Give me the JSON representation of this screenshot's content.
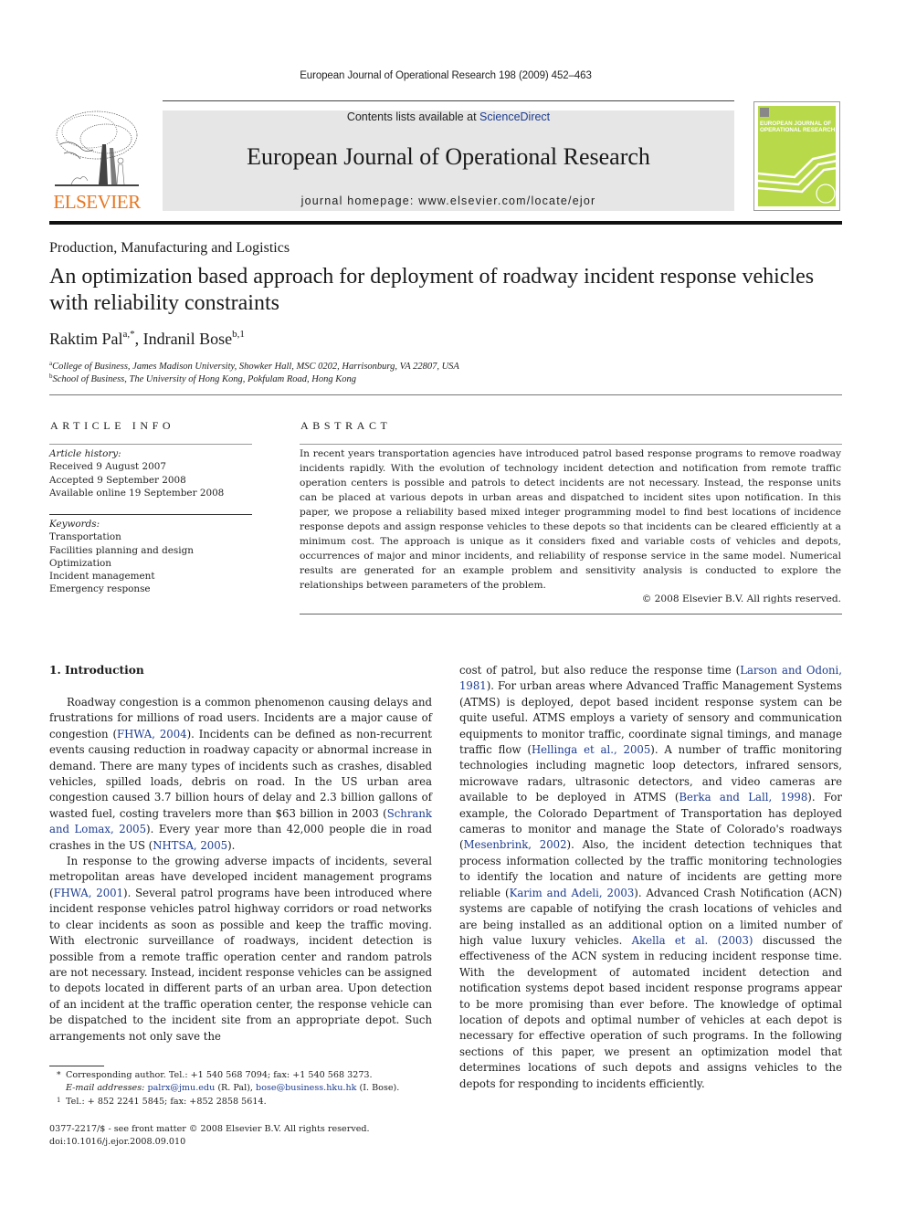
{
  "running_header": "European Journal of Operational Research 198 (2009) 452–463",
  "masthead": {
    "contents_prefix": "Contents lists available at ",
    "contents_link": "ScienceDirect",
    "journal_title": "European Journal of Operational Research",
    "homepage": "journal homepage: www.elsevier.com/locate/ejor",
    "publisher_logo_text": "ELSEVIER",
    "cover_title_line1": "EUROPEAN JOURNAL OF",
    "cover_title_line2": "OPERATIONAL RESEARCH",
    "colors": {
      "publisher_orange": "#e87722",
      "link_blue": "#1d3c8f",
      "cover_green": "#b8d94a",
      "box_grey": "#e6e6e6"
    }
  },
  "article": {
    "section": "Production, Manufacturing and Logistics",
    "title": "An optimization based approach for deployment of roadway incident response vehicles with reliability constraints",
    "authors": [
      {
        "name": "Raktim Pal",
        "marks": "a,*"
      },
      {
        "name": "Indranil Bose",
        "marks": "b,1"
      }
    ],
    "author_separator": ", ",
    "affiliations": [
      {
        "mark": "a",
        "text": "College of Business, James Madison University, Showker Hall, MSC 0202, Harrisonburg, VA 22807, USA"
      },
      {
        "mark": "b",
        "text": "School of Business, The University of Hong Kong, Pokfulam Road, Hong Kong"
      }
    ]
  },
  "article_info": {
    "heading": "ARTICLE INFO",
    "history_label": "Article history:",
    "history": [
      "Received 9 August 2007",
      "Accepted 9 September 2008",
      "Available online 19 September 2008"
    ],
    "keywords_label": "Keywords:",
    "keywords": [
      "Transportation",
      "Facilities planning and design",
      "Optimization",
      "Incident management",
      "Emergency response"
    ]
  },
  "abstract": {
    "heading": "ABSTRACT",
    "text": "In recent years transportation agencies have introduced patrol based response programs to remove road­way incidents rapidly. With the evolution of technology incident detection and notification from remote traffic operation centers is possible and patrols to detect incidents are not necessary. Instead, the response units can be placed at various depots in urban areas and dispatched to incident sites upon noti­fication. In this paper, we propose a reliability based mixed integer programming model to find best loca­tions of incidence response depots and assign response vehicles to these depots so that incidents can be cleared efficiently at a minimum cost. The approach is unique as it considers fixed and variable costs of vehicles and depots, occurrences of major and minor incidents, and reliability of response service in the same model. Numerical results are generated for an example problem and sensitivity analysis is con­ducted to explore the relationships between parameters of the problem.",
    "copyright": "© 2008 Elsevier B.V. All rights reserved."
  },
  "body": {
    "section_heading": "1. Introduction",
    "left_paragraphs": [
      [
        {
          "t": "Roadway congestion is a common phenomenon causing delays and frustrations for millions of road users. Incidents are a major cause of congestion ("
        },
        {
          "t": "FHWA, 2004",
          "cite": true
        },
        {
          "t": "). Incidents can be defined as non-recurrent events causing reduction in roadway capacity or abnormal increase in demand. There are many types of incidents such as crashes, disabled vehicles, spilled loads, debris on road. In the US urban area congestion caused 3.7 billion hours of delay and 2.3 billion gallons of wasted fuel, costing travelers more than $63 billion in 2003 ("
        },
        {
          "t": "Schrank and Lomax, 2005",
          "cite": true
        },
        {
          "t": "). Every year more than 42,000 people die in road crashes in the US ("
        },
        {
          "t": "NHTSA, 2005",
          "cite": true
        },
        {
          "t": ")."
        }
      ],
      [
        {
          "t": "In response to the growing adverse impacts of incidents, several metropolitan areas have developed incident management pro­grams ("
        },
        {
          "t": "FHWA, 2001",
          "cite": true
        },
        {
          "t": "). Several patrol programs have been intro­duced where incident response vehicles patrol highway corridors or road networks to clear incidents as soon as possible and keep the traffic moving. With electronic surveillance of roadways, inci­dent detection is possible from a remote traffic operation center and random patrols are not necessary. Instead, incident response vehicles can be assigned to depots located in different parts of an urban area. Upon detection of an incident at the traffic operation center, the response vehicle can be dispatched to the incident site from an appropriate depot. Such arrangements not only save the"
        }
      ]
    ],
    "right_paragraphs": [
      [
        {
          "t": "cost of patrol, but also reduce the response time ("
        },
        {
          "t": "Larson and Odoni, 1981",
          "cite": true
        },
        {
          "t": "). For urban areas where Advanced Traffic Management Sys­tems (ATMS) is deployed, depot based incident response system can be quite useful. ATMS employs a variety of sensory and com­munication equipments to monitor traffic, coordinate signal tim­ings, and manage traffic flow ("
        },
        {
          "t": "Hellinga et al., 2005",
          "cite": true
        },
        {
          "t": "). A number of traffic monitoring technologies including magnetic loop detectors, infrared sensors, microwave radars, ultrasonic detectors, and video cameras are available to be deployed in ATMS ("
        },
        {
          "t": "Berka and Lall, 1998",
          "cite": true
        },
        {
          "t": "). For example, the Colorado Department of Transportation has deployed cameras to monitor and manage the State of Colo­rado's roadways ("
        },
        {
          "t": "Mesenbrink, 2002",
          "cite": true
        },
        {
          "t": "). Also, the incident detection techniques that process information collected by the traffic moni­toring technologies to identify the location and nature of incidents are getting more reliable ("
        },
        {
          "t": "Karim and Adeli, 2003",
          "cite": true
        },
        {
          "t": "). Advanced Crash Notification (ACN) systems are capable of notifying the crash loca­tions of vehicles and are being installed as an additional option on a limited number of high value luxury vehicles. "
        },
        {
          "t": "Akella et al. (2003)",
          "cite": true
        },
        {
          "t": " discussed the effectiveness of the ACN system in reducing incident response time. With the development of automated incident detection and notification systems depot based incident response programs appear to be more promising than ever before. The knowledge of optimal location of depots and optimal number of vehicles at each depot is necessary for effective operation of such programs. In the following sections of this paper, we present an optimization model that determines locations of such depots and assigns vehicles to the depots for responding to incidents efficiently."
        }
      ]
    ]
  },
  "footnotes": {
    "corresponding_mark": "*",
    "corresponding_text": "Corresponding author. Tel.: +1 540 568 7094; fax: +1 540 568 3273.",
    "email_label": "E-mail addresses:",
    "email_1": "palrx@jmu.edu",
    "email_1_owner": " (R. Pal), ",
    "email_2": "bose@business.hku.hk",
    "email_2_owner": " (I. Bose).",
    "note1_mark": "1",
    "note1_text": "Tel.: + 852 2241 5845; fax: +852 2858 5614."
  },
  "issn_line": "0377-2217/$ - see front matter © 2008 Elsevier B.V. All rights reserved.",
  "doi": "doi:10.1016/j.ejor.2008.09.010"
}
